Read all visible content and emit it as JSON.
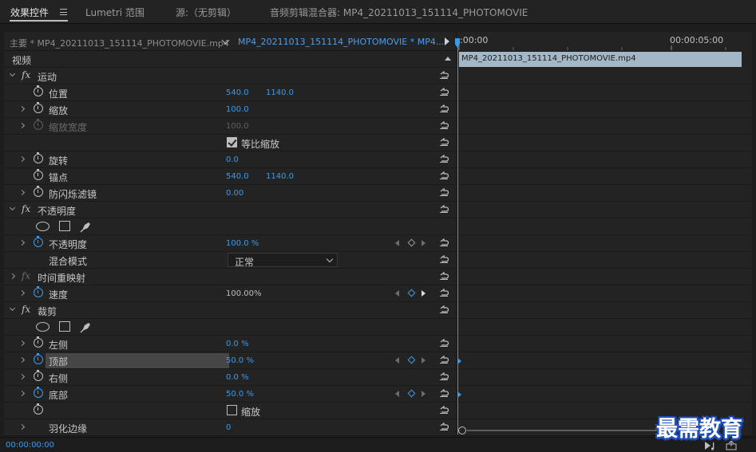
{
  "tabs": [
    {
      "label": "效果控件",
      "active": true
    },
    {
      "label": "Lumetri 范围",
      "active": false
    },
    {
      "label": "源:（无剪辑）",
      "active": false
    },
    {
      "label": "音频剪辑混合器: MP4_20211013_151114_PHOTOMOVIE",
      "active": false
    }
  ],
  "clipbar": {
    "master": "主要 * MP4_20211013_151114_PHOTOMOVIE.mp4",
    "sequence": "MP4_20211013_151114_PHOTOMOVIE * MP4..."
  },
  "section_video": "视频",
  "rows": [
    {
      "kind": "effect",
      "label": "运动",
      "open": true
    },
    {
      "kind": "prop",
      "label": "位置",
      "value": "540.0",
      "value2": "1140.0",
      "caret": false
    },
    {
      "kind": "prop",
      "label": "缩放",
      "value": "100.0",
      "caret": true
    },
    {
      "kind": "prop",
      "label": "缩放宽度",
      "value": "100.0",
      "caret": true,
      "dim": true
    },
    {
      "kind": "checkbox",
      "label": "等比缩放",
      "checked": true
    },
    {
      "kind": "prop",
      "label": "旋转",
      "value": "0.0",
      "caret": true
    },
    {
      "kind": "prop",
      "label": "锚点",
      "value": "540.0",
      "value2": "1140.0",
      "caret": false
    },
    {
      "kind": "prop",
      "label": "防闪烁滤镜",
      "value": "0.00",
      "caret": true
    },
    {
      "kind": "effect",
      "label": "不透明度",
      "open": true
    },
    {
      "kind": "shapes"
    },
    {
      "kind": "prop",
      "label": "不透明度",
      "value": "100.0 %",
      "caret": true,
      "blue_watch": true,
      "keyframes": "grey"
    },
    {
      "kind": "dropdown",
      "label": "混合模式",
      "value": "正常"
    },
    {
      "kind": "effect",
      "label": "时间重映射",
      "open": false,
      "dim_fx": true
    },
    {
      "kind": "prop",
      "label": "速度",
      "value": "100.00%",
      "caret": true,
      "blue_watch": true,
      "white_value": true,
      "keyframes": "blue-bright"
    },
    {
      "kind": "effect",
      "label": "裁剪",
      "open": true
    },
    {
      "kind": "shapes"
    },
    {
      "kind": "prop",
      "label": "左侧",
      "value": "0.0 %",
      "caret": true
    },
    {
      "kind": "prop",
      "label": "顶部",
      "value": "50.0 %",
      "caret": true,
      "blue_watch": true,
      "selected": true,
      "keyframes": "blue",
      "tl_key": true
    },
    {
      "kind": "prop",
      "label": "右侧",
      "value": "0.0 %",
      "caret": true
    },
    {
      "kind": "prop",
      "label": "底部",
      "value": "50.0 %",
      "caret": true,
      "blue_watch": true,
      "keyframes": "blue",
      "tl_key": true
    },
    {
      "kind": "checkbox",
      "label": "缩放",
      "checked": false,
      "watch": true
    },
    {
      "kind": "prop",
      "label": "羽化边缘",
      "value": "0",
      "caret": true,
      "no_watch": true
    }
  ],
  "timeline": {
    "start_time": ":00:00",
    "mid_time": "00:00:05:00",
    "clip_name": "MP4_20211013_151114_PHOTOMOVIE.mp4"
  },
  "status": {
    "timecode": "00:00:00:00"
  },
  "watermark": "最需教育",
  "colors": {
    "accent_blue": "#3d9ae8",
    "clip_block": "#a3b7c6",
    "panel_bg": "#232323"
  }
}
